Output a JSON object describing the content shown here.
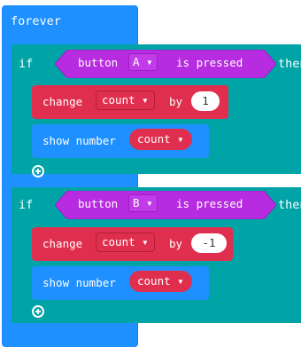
{
  "forever": {
    "label": "forever"
  },
  "if_blocks": [
    {
      "if_label": "if",
      "condition": {
        "prefix": "button",
        "button": "A",
        "suffix": "is pressed"
      },
      "then_label": "then",
      "change": {
        "label": "change",
        "variable": "count",
        "by_label": "by",
        "value": "1"
      },
      "show": {
        "label": "show number",
        "variable": "count"
      }
    },
    {
      "if_label": "if",
      "condition": {
        "prefix": "button",
        "button": "B",
        "suffix": "is pressed"
      },
      "then_label": "then",
      "change": {
        "label": "change",
        "variable": "count",
        "by_label": "by",
        "value": "-1"
      },
      "show": {
        "label": "show number",
        "variable": "count"
      }
    }
  ],
  "icons": {
    "dropdown": "chevron-down-icon",
    "add": "plus-circle-icon"
  },
  "colors": {
    "loops": "#1e90ff",
    "logic": "#00a4a6",
    "input": "#b72be1",
    "variables": "#e02f4e",
    "basic": "#1e90ff"
  }
}
